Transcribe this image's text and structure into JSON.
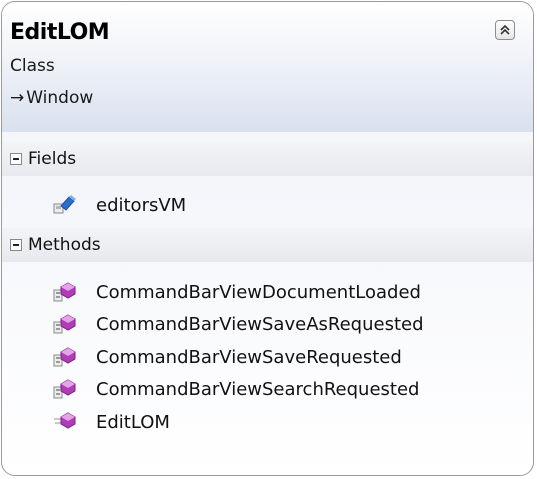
{
  "class_box": {
    "name": "EditLOM",
    "stereotype": "Class",
    "base_arrow": "→",
    "base_class": "Window",
    "collapse_icon": "double-chevron-up-icon"
  },
  "sections": {
    "fields": {
      "label": "Fields",
      "items": [
        {
          "name": "editorsVM",
          "icon": "field-icon"
        }
      ]
    },
    "methods": {
      "label": "Methods",
      "items": [
        {
          "name": "CommandBarViewDocumentLoaded",
          "icon": "private-method-icon"
        },
        {
          "name": "CommandBarViewSaveAsRequested",
          "icon": "private-method-icon"
        },
        {
          "name": "CommandBarViewSaveRequested",
          "icon": "private-method-icon"
        },
        {
          "name": "CommandBarViewSearchRequested",
          "icon": "private-method-icon"
        },
        {
          "name": "EditLOM",
          "icon": "public-method-icon"
        }
      ]
    }
  },
  "colors": {
    "method_icon": "#b03cb8",
    "field_icon": "#2a6fd0",
    "header_gradient_bottom": "#d9e1ef",
    "border": "#9a9a9a"
  }
}
